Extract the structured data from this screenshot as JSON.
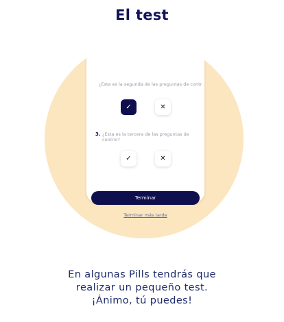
{
  "header": {
    "title": "El test"
  },
  "quiz": {
    "question2_text": "¿Esta es la segunda de las preguntas de control?",
    "question3_number": "3.",
    "question3_text": "¿Esta es la tercera de las preguntas de control?",
    "yes_icon": "✓",
    "no_icon": "✕",
    "finish_label": "Terminar",
    "finish_later_label": "Terminar más tarde"
  },
  "caption": {
    "line1": "En algunas Pills tendrás que",
    "line2": "realizar un pequeño test.",
    "line3": "¡Ánimo, tú puedes!"
  },
  "colors": {
    "accent": "#0f0f4e",
    "circle_bg": "#fbe6c0",
    "link": "#5b6bb0"
  }
}
